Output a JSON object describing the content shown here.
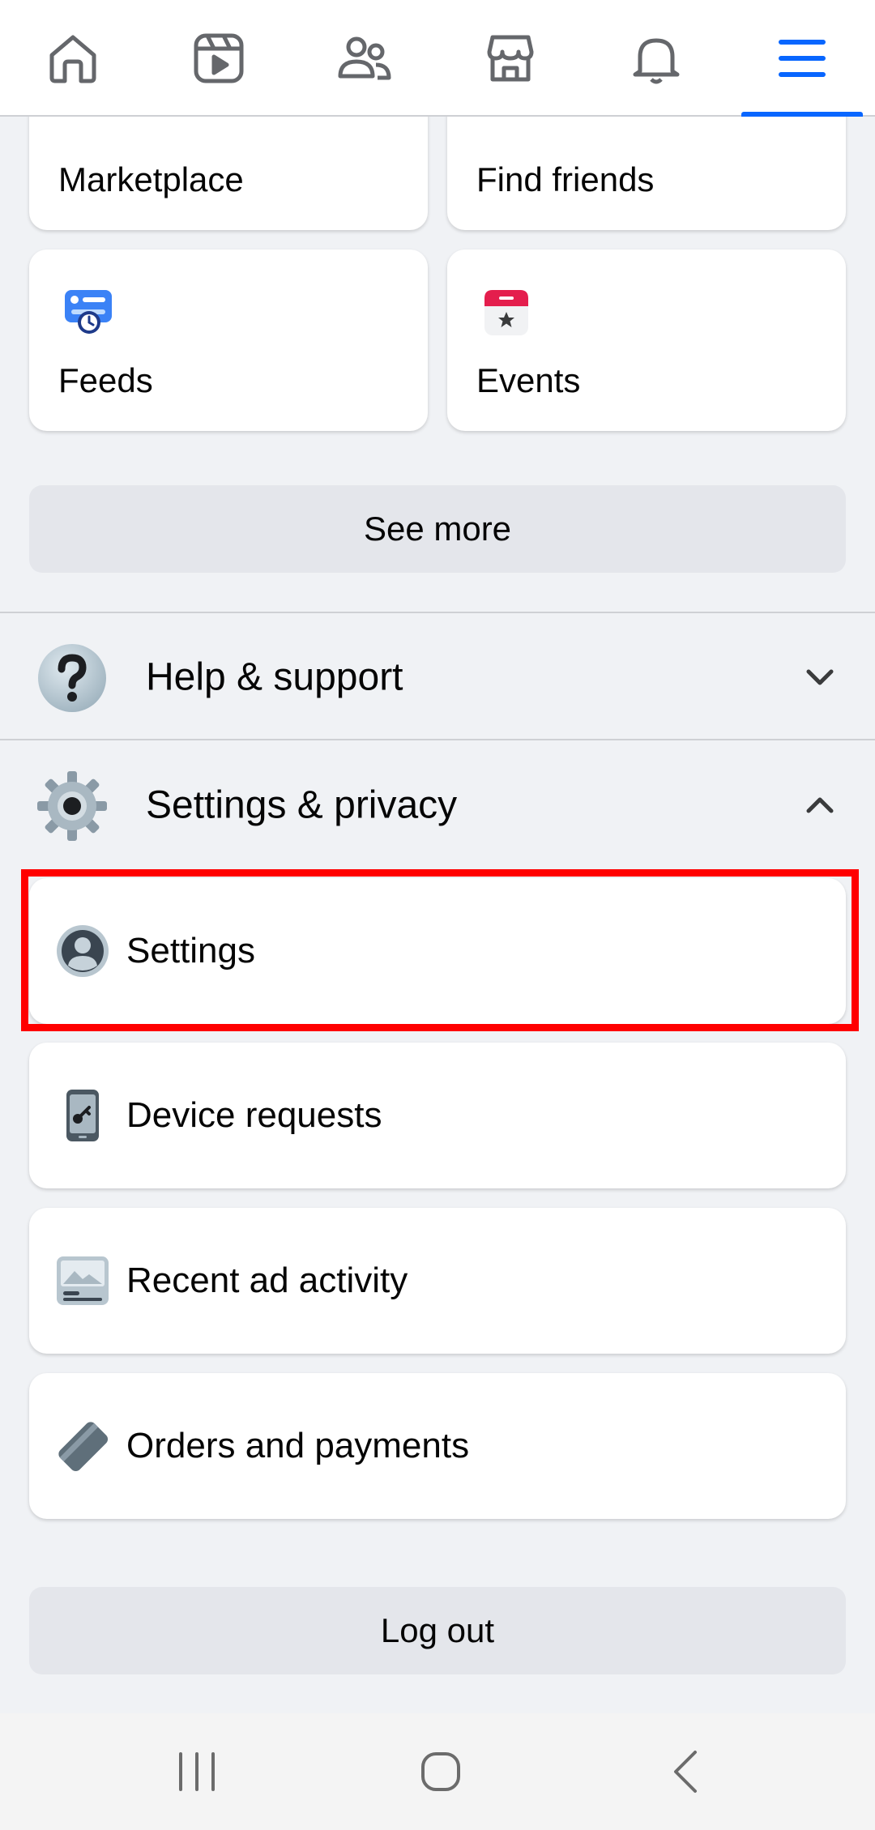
{
  "topnav": {
    "tabs": [
      {
        "name": "home",
        "icon": "home-icon"
      },
      {
        "name": "video",
        "icon": "video-icon"
      },
      {
        "name": "friends",
        "icon": "friends-icon"
      },
      {
        "name": "marketplace",
        "icon": "marketplace-icon"
      },
      {
        "name": "notifications",
        "icon": "bell-icon"
      },
      {
        "name": "menu",
        "icon": "hamburger-icon",
        "active": true
      }
    ],
    "accent_color": "#0866ff"
  },
  "shortcuts": [
    {
      "label": "Marketplace",
      "icon": "marketplace-icon"
    },
    {
      "label": "Find friends",
      "icon": "find-friends-icon"
    },
    {
      "label": "Feeds",
      "icon": "feeds-icon"
    },
    {
      "label": "Events",
      "icon": "events-calendar-icon"
    }
  ],
  "see_more_label": "See more",
  "help_section": {
    "label": "Help & support",
    "icon": "question-mark-icon",
    "state": "collapsed"
  },
  "settings_section": {
    "label": "Settings & privacy",
    "icon": "gear-icon",
    "state": "expanded",
    "items": [
      {
        "label": "Settings",
        "icon": "profile-icon",
        "highlighted": true
      },
      {
        "label": "Device requests",
        "icon": "phone-key-icon"
      },
      {
        "label": "Recent ad activity",
        "icon": "ad-image-icon"
      },
      {
        "label": "Orders and payments",
        "icon": "card-icon"
      }
    ]
  },
  "logout_label": "Log out",
  "highlight_color": "#ff0000",
  "system_nav": [
    "recent-apps-icon",
    "home-circle-icon",
    "back-icon"
  ]
}
